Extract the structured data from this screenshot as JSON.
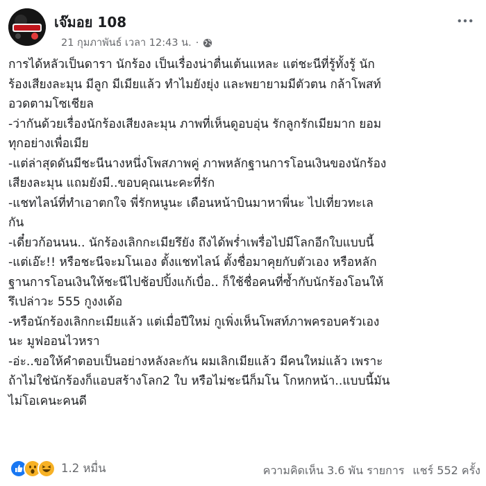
{
  "post": {
    "page_name": "เจ๊มอย 108",
    "timestamp": "21 กุมภาพันธ์ เวลา 12:43 น.",
    "separator": "·",
    "avatar_text": "เจ๊มอย",
    "lines": [
      "การได้หลัวเป็นดารา นักร้อง เป็นเรื่องน่าตื่นเต้นแหละ แต่ชะนีที่รู้ทั้งรู้ นัก",
      "ร้องเสียงละมุน มีลูก มีเมียแล้ว ทำไมยังยุ่ง และพยายามมีตัวตน กล้าโพสท์",
      "อวดตามโซเชียล",
      "-ว่ากันด้วยเรื่องนักร้องเสียงละมุน ภาพที่เห็นดูอบอุ่น รักลูกรักเมียมาก ยอม",
      "ทุกอย่างเพื่อเมีย",
      "-แต่ล่าสุดดันมีชะนีนางหนึ่งโพสภาพคู่ ภาพหลักฐานการโอนเงินของนักร้อง",
      "เสียงละมุน แถมยังมี..ขอบคุณเนะคะที่รัก",
      "-แชทไลน์ที่ทำเอาตกใจ พี่รักหนูนะ เดือนหน้าบินมาหาพี่นะ ไปเที่ยวทะเล",
      "กัน",
      "-เดี๋ยวก้อนนน.. นักร้องเลิกกะเมียรึยัง ถึงได้พร่ำเพรื่อไปมีโลกอีกใบแบบนี้",
      "-แต่เอ๊ะ!! หรือชะนีจะมโนเอง ตั้งแชทไลน์ ตั้งชื่อมาคุยกับตัวเอง หรือหลัก",
      "ฐานการโอนเงินให้ชะนีไปช้อปปิ้งแก้เบื่อ.. ก็ใช้ชื่อคนที่ซ้ำกับนักร้องโอนให้",
      "รึเปล่าวะ 555 กูงงเด้อ",
      "-หรือนักร้องเลิกกะเมียแล้ว แต่เมื่อปีใหม่ กูเพิ่งเห็นโพสท์ภาพครอบครัวเอง",
      "นะ มูฟออนไวหรา",
      "-อ่ะ..ขอให้คำตอบเป็นอย่างหลังละกัน ผมเลิกเมียแล้ว มีคนใหม่แล้ว เพราะ",
      "ถ้าไม่ใช่นักร้องก็แอบสร้างโลก2 ใบ หรือไม่ชะนีก็มโน โกหกหน้า..แบบนี้มัน",
      "ไม่โอเคนะคนดี"
    ]
  },
  "footer": {
    "reaction_icons": [
      "like-icon",
      "wow-icon",
      "haha-icon"
    ],
    "reaction_count": "1.2 หมื่น",
    "comments": "ความคิดเห็น 3.6 พัน รายการ",
    "shares": "แชร์ 552 ครั้ง"
  },
  "colors": {
    "text": "#1c1e21",
    "secondary": "#65676b",
    "like_blue": "#1877f2",
    "emoji_yellow": "#f7b125"
  }
}
